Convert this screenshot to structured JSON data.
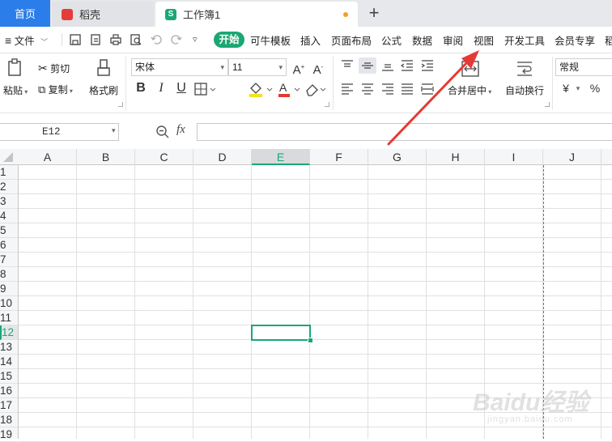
{
  "tabs": {
    "home": "首页",
    "daoke": "稻壳",
    "workbook": "工作簿1",
    "workbook_logo": "S"
  },
  "menubar": {
    "file": "文件",
    "items": [
      "开始",
      "可牛模板",
      "插入",
      "页面布局",
      "公式",
      "数据",
      "审阅",
      "视图",
      "开发工具",
      "会员专享",
      "稻"
    ]
  },
  "ribbon": {
    "paste": "粘贴",
    "cut": "剪切",
    "copy": "复制",
    "format_painter": "格式刷",
    "font_name": "宋体",
    "font_size": "11",
    "merge_center": "合并居中",
    "wrap_text": "自动换行",
    "number_format": "常规",
    "currency_symbol": "¥",
    "percent_symbol": "%"
  },
  "formula_bar": {
    "cell_ref": "E12",
    "fx_label": "fx",
    "content": ""
  },
  "grid": {
    "columns": [
      "A",
      "B",
      "C",
      "D",
      "E",
      "F",
      "G",
      "H",
      "I",
      "J"
    ],
    "rows": [
      "1",
      "2",
      "3",
      "4",
      "5",
      "6",
      "7",
      "8",
      "9",
      "10",
      "11",
      "12",
      "13",
      "14",
      "15",
      "16",
      "17",
      "18",
      "19"
    ],
    "selected_column": "E",
    "selected_row": "12"
  },
  "colors": {
    "accent": "#1ba774",
    "home_tab": "#2b7de9",
    "arrow": "#e53935"
  },
  "watermark": {
    "brand": "Baidu经验",
    "url": "jingyan.baidu.com"
  }
}
